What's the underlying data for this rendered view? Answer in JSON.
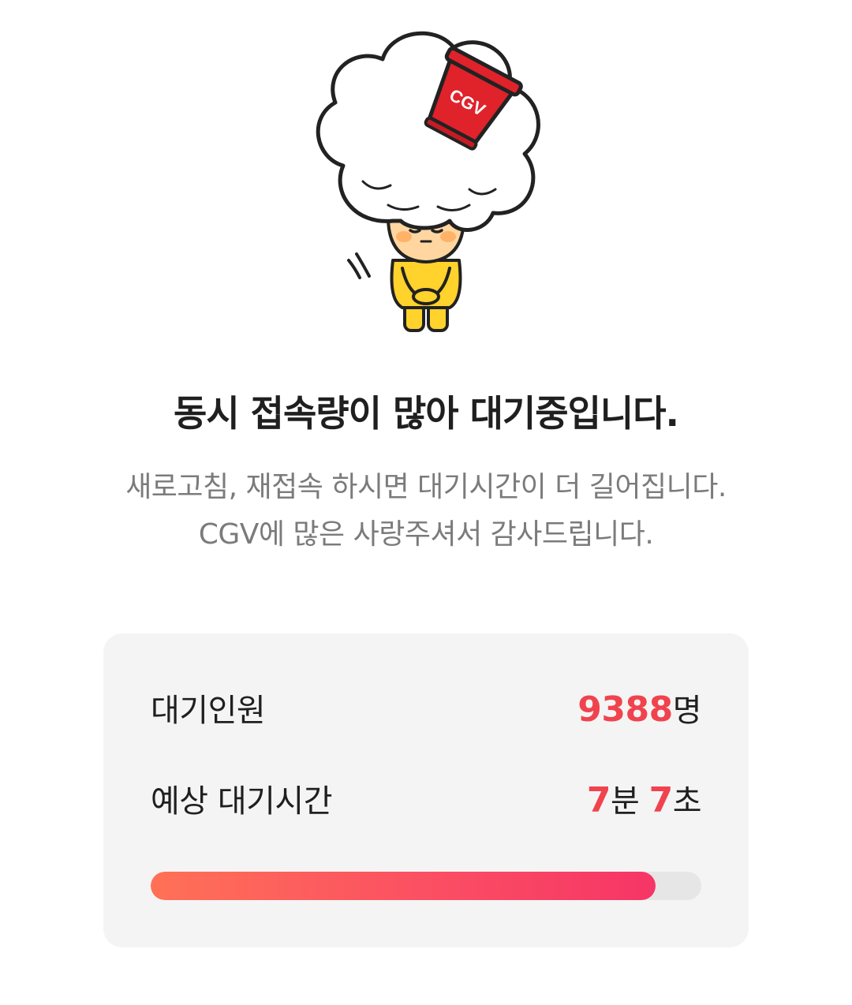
{
  "mascot": {
    "icon": "cgv-popcorn-mascot-bowing-icon",
    "cup_text": "CGV",
    "cup_color": "#e0222b",
    "body_color": "#ffd22c"
  },
  "headline": "동시 접속량이 많아 대기중입니다.",
  "subtext": {
    "line1": "새로고침, 재접속 하시면 대기시간이 더 길어집니다.",
    "line2": "CGV에 많은 사랑주셔서 감사드립니다."
  },
  "queue": {
    "waiting_label": "대기인원",
    "waiting_count": "9388",
    "waiting_unit": "명",
    "eta_label": "예상 대기시간",
    "eta_minutes": "7",
    "eta_minutes_unit": "분",
    "eta_seconds": "7",
    "eta_seconds_unit": "초",
    "progress": 0.917
  },
  "colors": {
    "accent": "#f0434e",
    "progress_start": "#ff7156",
    "progress_end": "#f63566",
    "card_bg": "#f4f4f4",
    "track_bg": "#e6e6e6"
  }
}
